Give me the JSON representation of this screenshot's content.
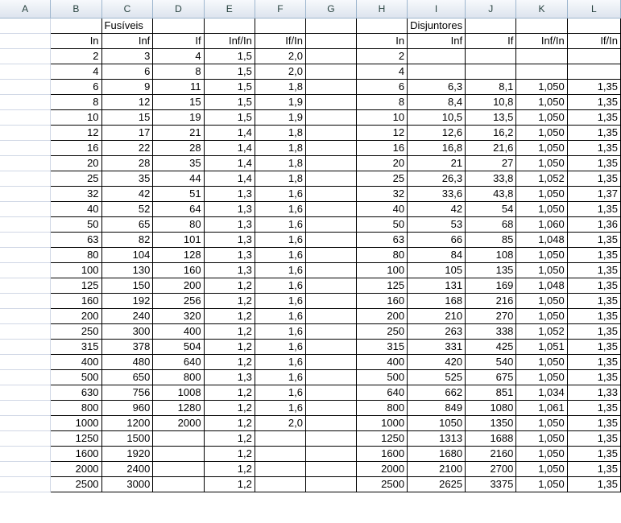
{
  "columns": [
    "A",
    "B",
    "C",
    "D",
    "E",
    "F",
    "G",
    "H",
    "I",
    "J",
    "K",
    "L"
  ],
  "sections": {
    "fusiveis_title": "Fusíveis",
    "disjuntores_title": "Disjuntores"
  },
  "fusiveis_headers": [
    "In",
    "Inf",
    "If",
    "Inf/In",
    "If/In"
  ],
  "disjuntores_headers": [
    "In",
    "Inf",
    "If",
    "Inf/In",
    "If/In"
  ],
  "fusiveis_rows": [
    [
      "2",
      "3",
      "4",
      "1,5",
      "2,0"
    ],
    [
      "4",
      "6",
      "8",
      "1,5",
      "2,0"
    ],
    [
      "6",
      "9",
      "11",
      "1,5",
      "1,8"
    ],
    [
      "8",
      "12",
      "15",
      "1,5",
      "1,9"
    ],
    [
      "10",
      "15",
      "19",
      "1,5",
      "1,9"
    ],
    [
      "12",
      "17",
      "21",
      "1,4",
      "1,8"
    ],
    [
      "16",
      "22",
      "28",
      "1,4",
      "1,8"
    ],
    [
      "20",
      "28",
      "35",
      "1,4",
      "1,8"
    ],
    [
      "25",
      "35",
      "44",
      "1,4",
      "1,8"
    ],
    [
      "32",
      "42",
      "51",
      "1,3",
      "1,6"
    ],
    [
      "40",
      "52",
      "64",
      "1,3",
      "1,6"
    ],
    [
      "50",
      "65",
      "80",
      "1,3",
      "1,6"
    ],
    [
      "63",
      "82",
      "101",
      "1,3",
      "1,6"
    ],
    [
      "80",
      "104",
      "128",
      "1,3",
      "1,6"
    ],
    [
      "100",
      "130",
      "160",
      "1,3",
      "1,6"
    ],
    [
      "125",
      "150",
      "200",
      "1,2",
      "1,6"
    ],
    [
      "160",
      "192",
      "256",
      "1,2",
      "1,6"
    ],
    [
      "200",
      "240",
      "320",
      "1,2",
      "1,6"
    ],
    [
      "250",
      "300",
      "400",
      "1,2",
      "1,6"
    ],
    [
      "315",
      "378",
      "504",
      "1,2",
      "1,6"
    ],
    [
      "400",
      "480",
      "640",
      "1,2",
      "1,6"
    ],
    [
      "500",
      "650",
      "800",
      "1,3",
      "1,6"
    ],
    [
      "630",
      "756",
      "1008",
      "1,2",
      "1,6"
    ],
    [
      "800",
      "960",
      "1280",
      "1,2",
      "1,6"
    ],
    [
      "1000",
      "1200",
      "2000",
      "1,2",
      "2,0"
    ],
    [
      "1250",
      "1500",
      "",
      "1,2",
      ""
    ],
    [
      "1600",
      "1920",
      "",
      "1,2",
      ""
    ],
    [
      "2000",
      "2400",
      "",
      "1,2",
      ""
    ],
    [
      "2500",
      "3000",
      "",
      "1,2",
      ""
    ]
  ],
  "disjuntores_rows": [
    [
      "2",
      "",
      "",
      "",
      ""
    ],
    [
      "4",
      "",
      "",
      "",
      ""
    ],
    [
      "6",
      "6,3",
      "8,1",
      "1,050",
      "1,35"
    ],
    [
      "8",
      "8,4",
      "10,8",
      "1,050",
      "1,35"
    ],
    [
      "10",
      "10,5",
      "13,5",
      "1,050",
      "1,35"
    ],
    [
      "12",
      "12,6",
      "16,2",
      "1,050",
      "1,35"
    ],
    [
      "16",
      "16,8",
      "21,6",
      "1,050",
      "1,35"
    ],
    [
      "20",
      "21",
      "27",
      "1,050",
      "1,35"
    ],
    [
      "25",
      "26,3",
      "33,8",
      "1,052",
      "1,35"
    ],
    [
      "32",
      "33,6",
      "43,8",
      "1,050",
      "1,37"
    ],
    [
      "40",
      "42",
      "54",
      "1,050",
      "1,35"
    ],
    [
      "50",
      "53",
      "68",
      "1,060",
      "1,36"
    ],
    [
      "63",
      "66",
      "85",
      "1,048",
      "1,35"
    ],
    [
      "80",
      "84",
      "108",
      "1,050",
      "1,35"
    ],
    [
      "100",
      "105",
      "135",
      "1,050",
      "1,35"
    ],
    [
      "125",
      "131",
      "169",
      "1,048",
      "1,35"
    ],
    [
      "160",
      "168",
      "216",
      "1,050",
      "1,35"
    ],
    [
      "200",
      "210",
      "270",
      "1,050",
      "1,35"
    ],
    [
      "250",
      "263",
      "338",
      "1,052",
      "1,35"
    ],
    [
      "315",
      "331",
      "425",
      "1,051",
      "1,35"
    ],
    [
      "400",
      "420",
      "540",
      "1,050",
      "1,35"
    ],
    [
      "500",
      "525",
      "675",
      "1,050",
      "1,35"
    ],
    [
      "640",
      "662",
      "851",
      "1,034",
      "1,33"
    ],
    [
      "800",
      "849",
      "1080",
      "1,061",
      "1,35"
    ],
    [
      "1000",
      "1050",
      "1350",
      "1,050",
      "1,35"
    ],
    [
      "1250",
      "1313",
      "1688",
      "1,050",
      "1,35"
    ],
    [
      "1600",
      "1680",
      "2160",
      "1,050",
      "1,35"
    ],
    [
      "2000",
      "2100",
      "2700",
      "1,050",
      "1,35"
    ],
    [
      "2500",
      "2625",
      "3375",
      "1,050",
      "1,35"
    ]
  ]
}
